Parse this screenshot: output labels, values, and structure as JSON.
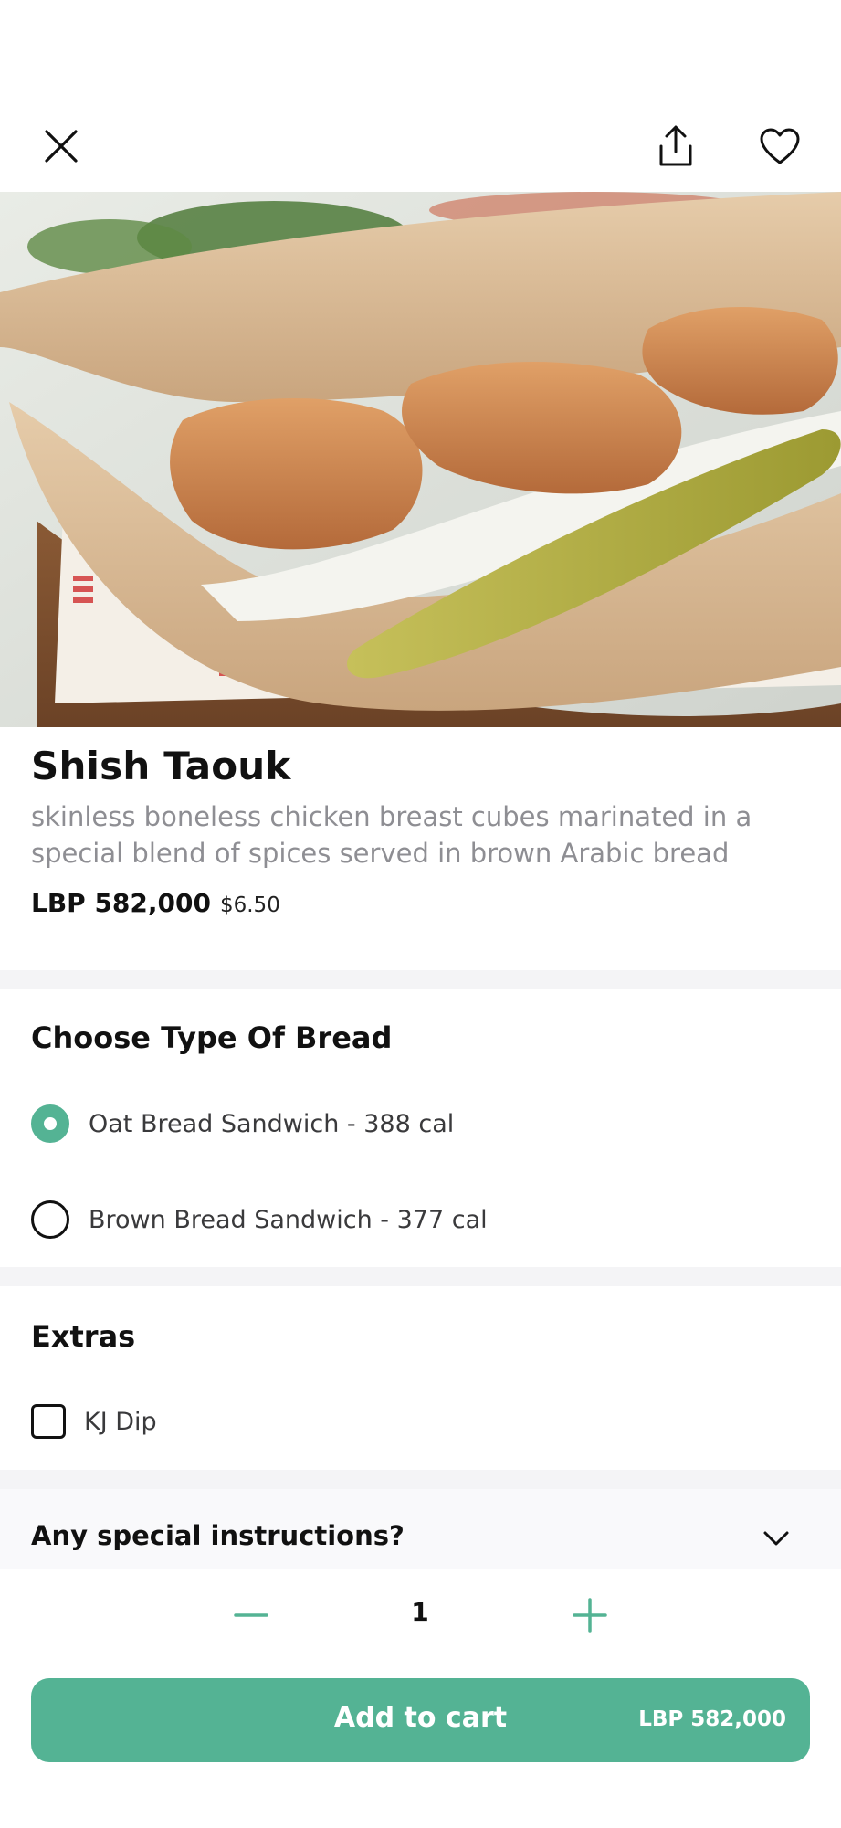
{
  "header": {
    "close_icon": "close-icon",
    "share_icon": "share-icon",
    "favorite_icon": "heart-icon"
  },
  "product": {
    "name": "Shish Taouk",
    "description": "skinless boneless chicken breast cubes marinated in a special blend of spices served in brown Arabic bread",
    "price_lbp": "LBP 582,000",
    "price_usd": "$6.50"
  },
  "bread_section": {
    "title": "Choose Type Of Bread",
    "options": [
      {
        "label": "Oat Bread Sandwich - 388 cal",
        "selected": true
      },
      {
        "label": "Brown Bread Sandwich - 377 cal",
        "selected": false
      }
    ]
  },
  "extras_section": {
    "title": "Extras",
    "items": [
      {
        "label": "KJ Dip",
        "checked": false
      }
    ]
  },
  "instructions": {
    "label": "Any special instructions?"
  },
  "quantity": {
    "value": "1"
  },
  "cart": {
    "label": "Add to cart",
    "price": "LBP 582,000"
  },
  "colors": {
    "accent": "#54b394",
    "muted_text": "#8e8e93",
    "separator": "#f4f4f6"
  }
}
